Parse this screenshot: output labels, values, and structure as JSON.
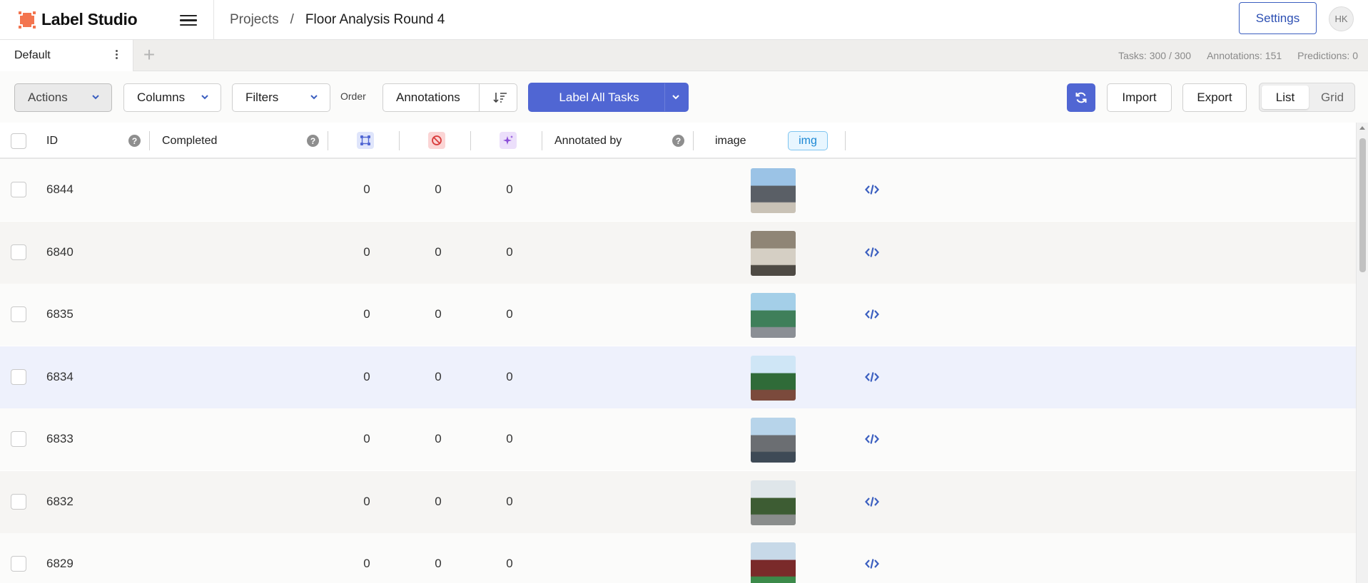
{
  "app": {
    "name": "Label Studio",
    "accent": "#5066d3",
    "logo_color": "#f3754f"
  },
  "breadcrumb": {
    "projects": "Projects",
    "separator": "/",
    "project": "Floor Analysis Round 4"
  },
  "header": {
    "settings_label": "Settings",
    "avatar_initials": "HK"
  },
  "tabs": [
    {
      "label": "Default",
      "active": true
    }
  ],
  "stats": {
    "tasks": "Tasks: 300 / 300",
    "annotations": "Annotations: 151",
    "predictions": "Predictions: 0"
  },
  "toolbar": {
    "actions": "Actions",
    "columns": "Columns",
    "filters": "Filters",
    "order_label": "Order",
    "order_value": "Annotations",
    "label_all": "Label All Tasks",
    "import": "Import",
    "export": "Export",
    "view_list": "List",
    "view_grid": "Grid",
    "active_view": "List"
  },
  "columns": {
    "id": "ID",
    "completed": "Completed",
    "annotations_icon": "annotations-icon",
    "cancelled_icon": "cancelled-icon",
    "predictions_icon": "predictions-icon",
    "annotated_by": "Annotated by",
    "image": "image",
    "image_tag": "img"
  },
  "rows": [
    {
      "id": "6844",
      "completed": "",
      "annotations": "0",
      "cancelled": "0",
      "predictions": "0",
      "highlighted": false
    },
    {
      "id": "6840",
      "completed": "",
      "annotations": "0",
      "cancelled": "0",
      "predictions": "0",
      "highlighted": false
    },
    {
      "id": "6835",
      "completed": "",
      "annotations": "0",
      "cancelled": "0",
      "predictions": "0",
      "highlighted": false
    },
    {
      "id": "6834",
      "completed": "",
      "annotations": "0",
      "cancelled": "0",
      "predictions": "0",
      "highlighted": true
    },
    {
      "id": "6833",
      "completed": "",
      "annotations": "0",
      "cancelled": "0",
      "predictions": "0",
      "highlighted": false
    },
    {
      "id": "6832",
      "completed": "",
      "annotations": "0",
      "cancelled": "0",
      "predictions": "0",
      "highlighted": false
    },
    {
      "id": "6829",
      "completed": "",
      "annotations": "0",
      "cancelled": "0",
      "predictions": "0",
      "highlighted": false
    }
  ]
}
